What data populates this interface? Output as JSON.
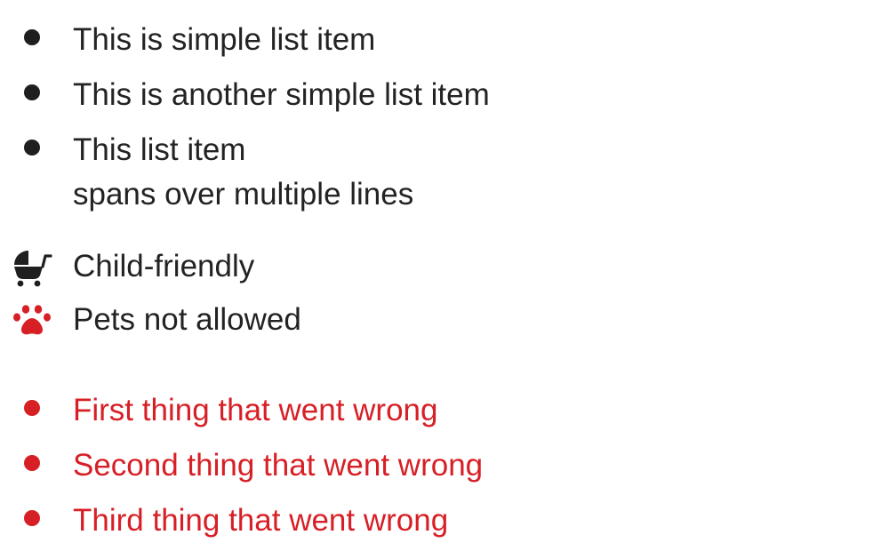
{
  "simple_list": {
    "items": [
      {
        "lines": [
          "This is simple list item"
        ]
      },
      {
        "lines": [
          "This is another simple list item"
        ]
      },
      {
        "lines": [
          "This list item",
          "spans over multiple lines"
        ]
      }
    ],
    "text_color": "#232323",
    "bullet_color": "#1f1f1f"
  },
  "icon_list": {
    "items": [
      {
        "icon": "baby-carriage-icon",
        "label": "Child-friendly",
        "icon_color": "#1f1f1f"
      },
      {
        "icon": "paw-icon",
        "label": "Pets not allowed",
        "icon_color": "#d71f26"
      }
    ]
  },
  "error_list": {
    "items": [
      "First thing that went wrong",
      "Second thing that went wrong",
      "Third thing that went wrong"
    ],
    "color": "#d71f26"
  }
}
